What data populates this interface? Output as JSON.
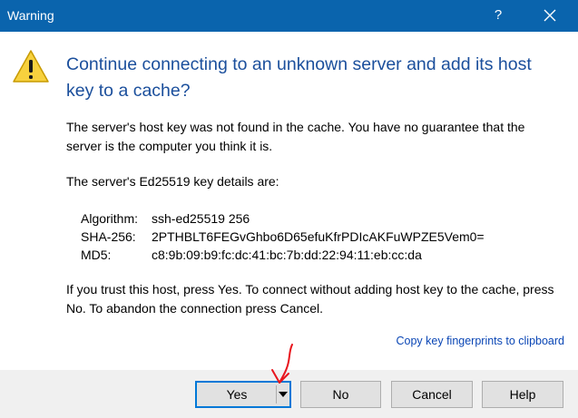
{
  "window": {
    "title": "Warning",
    "help_glyph": "?"
  },
  "dialog": {
    "heading": "Continue connecting to an unknown server and add its host key to a cache?",
    "message1": "The server's host key was not found in the cache. You have no guarantee that the server is the computer you think it is.",
    "message2": "The server's Ed25519 key details are:",
    "key_details": [
      {
        "label": "Algorithm:",
        "value": "ssh-ed25519 256"
      },
      {
        "label": "SHA-256:",
        "value": "2PTHBLT6FEGvGhbo6D65efuKfrPDIcAKFuWPZE5Vem0="
      },
      {
        "label": "MD5:",
        "value": "c8:9b:09:b9:fc:dc:41:bc:7b:dd:22:94:11:eb:cc:da"
      }
    ],
    "message3": "If you trust this host, press Yes. To connect without adding host key to the cache, press No. To abandon the connection press Cancel.",
    "copy_link": "Copy key fingerprints to clipboard"
  },
  "buttons": {
    "yes": "Yes",
    "no": "No",
    "cancel": "Cancel",
    "help": "Help"
  },
  "icons": {
    "warning": "warning-triangle-icon",
    "close": "close-icon",
    "dropdown": "chevron-down-icon"
  },
  "colors": {
    "titlebar": "#0a64ad",
    "heading": "#1b4f9c",
    "link": "#0a46b5",
    "annotation": "#e8141c"
  }
}
